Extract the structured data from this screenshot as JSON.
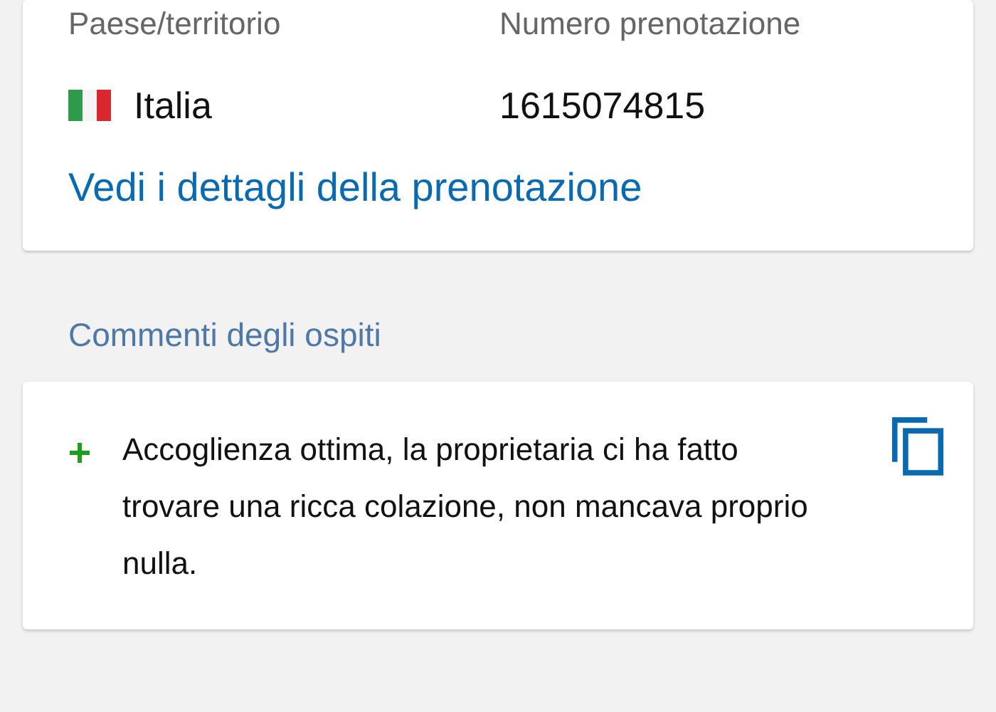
{
  "booking": {
    "fields": [
      {
        "label": "Paese/territorio",
        "value": "Italia",
        "kind": "country"
      },
      {
        "label": "Numero prenotazione",
        "value": "1615074815",
        "kind": "text"
      }
    ],
    "link": "Vedi i dettagli della prenotazione"
  },
  "comments": {
    "title": "Commenti degli ospiti",
    "items": [
      {
        "kind": "positive",
        "text": "Accoglienza ottima, la proprietaria ci ha fatto trovare una ricca colazione, non mancava proprio nulla."
      }
    ]
  }
}
